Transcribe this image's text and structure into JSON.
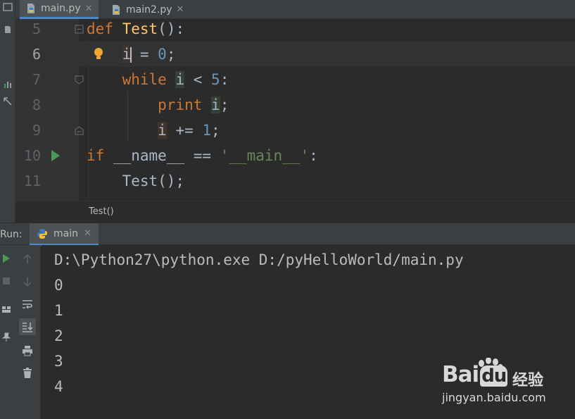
{
  "tabs": [
    {
      "label": "main.py",
      "active": true
    },
    {
      "label": "main2.py",
      "active": false
    }
  ],
  "editor": {
    "lines": [
      {
        "num": "5",
        "code": "def Test():"
      },
      {
        "num": "6",
        "code": "    i = 0;",
        "current": true
      },
      {
        "num": "7",
        "code": "    while i < 5:"
      },
      {
        "num": "8",
        "code": "        print i;"
      },
      {
        "num": "9",
        "code": "        i += 1;"
      },
      {
        "num": "10",
        "code": "if __name__ == '__main__':"
      },
      {
        "num": "11",
        "code": "    Test();"
      }
    ]
  },
  "breadcrumb": "Test()",
  "run_panel": {
    "label": "Run:",
    "tab": "main",
    "console_lines": [
      "D:\\Python27\\python.exe D:/pyHelloWorld/main.py",
      "0",
      "1",
      "2",
      "3",
      "4"
    ]
  },
  "watermark": {
    "brand": "Bai",
    "brand_tail": "du",
    "cn": "经验",
    "url": "jingyan.baidu.com"
  },
  "colors": {
    "keyword": "#cc7832",
    "function": "#ffc66d",
    "number": "#6897bb",
    "string": "#6a8759",
    "default": "#a9b7c6",
    "run_green": "#499c54",
    "accent": "#4a88c7"
  },
  "icons": [
    "python-file-icon",
    "close-icon",
    "bulb-icon",
    "run-arrow-icon",
    "fold-icon",
    "rerun-icon",
    "stop-icon",
    "up-arrow-icon",
    "down-arrow-icon",
    "soft-wrap-icon",
    "scroll-to-end-icon",
    "print-icon",
    "trash-icon",
    "pin-icon",
    "layout-icon"
  ]
}
